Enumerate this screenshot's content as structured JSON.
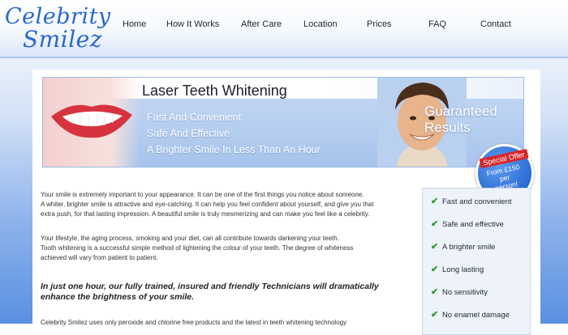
{
  "logo": {
    "line1": "Celebrity",
    "line2": "Smilez"
  },
  "nav": [
    "Home",
    "How It Works",
    "After Care",
    "Location",
    "Prices",
    "FAQ",
    "Contact"
  ],
  "banner": {
    "title": "Laser Teeth Whitening",
    "lines": [
      "Fast And Convenient",
      "Safe And Effective",
      "A Brighter Smile In Less Than An Hour"
    ],
    "guarantee": [
      "Guaranteed",
      "Results"
    ],
    "offer": {
      "label": "Special Offer",
      "text": [
        "From £150",
        "per",
        "person!"
      ]
    }
  },
  "intro": [
    "Your smile is extremely important to your appearance. It can be one of the first things you notice about someone.",
    "A whiter, brighter smile is attractive and eye-catching. It can help you feel confident about yourself, and give you that",
    "extra push, for that lasting impression. A beautiful smile is truly mesmerizing and can make you feel like a celebrity."
  ],
  "lifestyle": [
    "Your lifestyle, the aging process, smoking and your diet, can all contribute towards darkening your teeth.",
    "Tooth whitening is a successful simple method of lightening the colour of your teeth. The degree of whiteness",
    "achieved will vary from patient to patient."
  ],
  "highlight": "In just one hour, our fully trained, insured and friendly Technicians will dramatically enhance the brightness of your smile.",
  "footer_text": "Celebrity Smilez uses only peroxide and chlorine free products and the latest in teeth whitening technology",
  "features": [
    "Fast and convenient",
    "Safe and effective",
    "A brighter smile",
    "Long lasting",
    "No sensitivity",
    "No enamel damage"
  ],
  "colors": {
    "brand_blue": "#2a67c9",
    "check_green": "#2f9a2b",
    "offer_red": "#d8262c"
  }
}
